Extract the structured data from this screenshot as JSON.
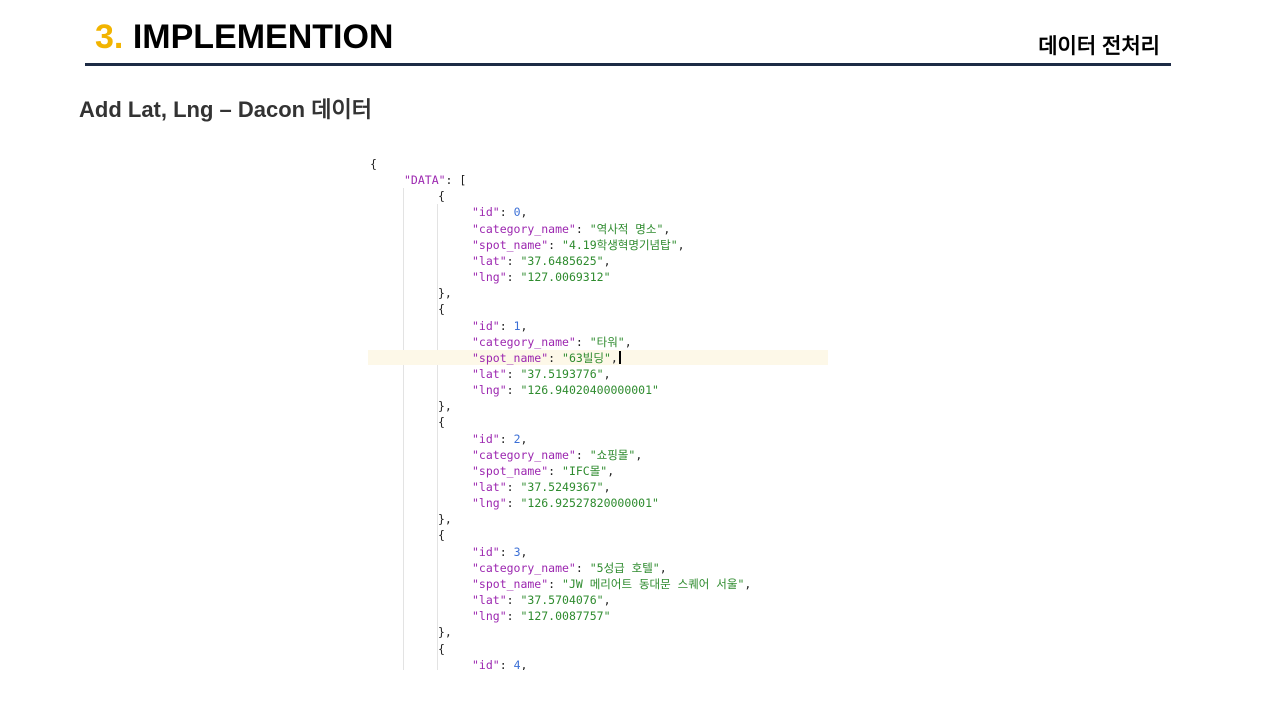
{
  "header": {
    "number": "3.",
    "title": "IMPLEMENTION",
    "section": "데이터 전처리"
  },
  "subtitle": "Add Lat, Lng – Dacon 데이터",
  "code": {
    "root_key": "\"DATA\"",
    "entries": [
      {
        "id": "0",
        "category_name": "\"역사적 명소\"",
        "spot_name": "\"4.19학생혁명기념탑\"",
        "lat": "\"37.6485625\"",
        "lng": "\"127.0069312\""
      },
      {
        "id": "1",
        "category_name": "\"타워\"",
        "spot_name": "\"63빌딩\"",
        "lat": "\"37.5193776\"",
        "lng": "\"126.94020400000001\""
      },
      {
        "id": "2",
        "category_name": "\"쇼핑몰\"",
        "spot_name": "\"IFC몰\"",
        "lat": "\"37.5249367\"",
        "lng": "\"126.92527820000001\""
      },
      {
        "id": "3",
        "category_name": "\"5성급 호텔\"",
        "spot_name": "\"JW 메리어트 동대문 스퀘어 서울\"",
        "lat": "\"37.5704076\"",
        "lng": "\"127.0087757\""
      },
      {
        "id": "4"
      }
    ]
  }
}
